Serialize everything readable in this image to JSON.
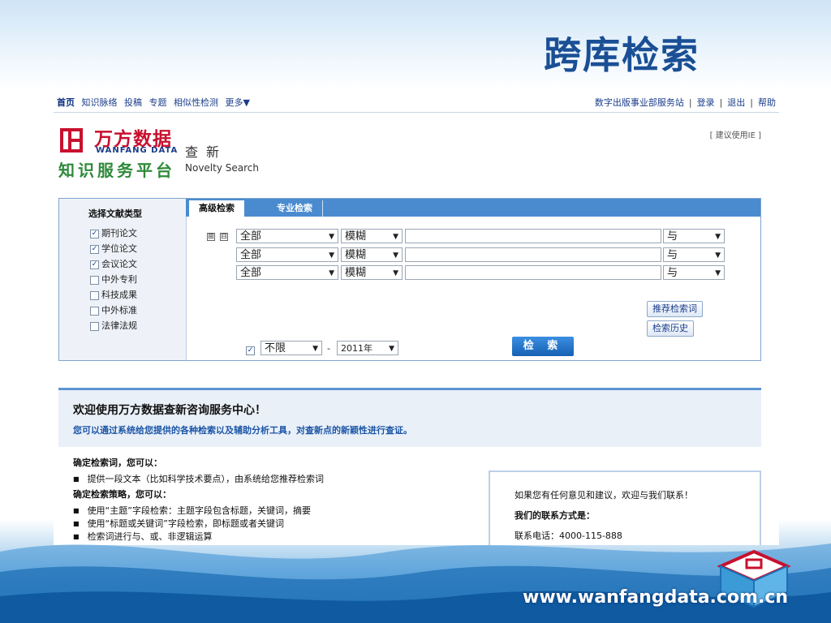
{
  "slide": {
    "title": "跨库检索",
    "url": "www.wanfangdata.com.cn"
  },
  "nav": {
    "home": "首页",
    "items": [
      "知识脉络",
      "投稿",
      "专题",
      "相似性检测",
      "更多▼"
    ],
    "right_links": [
      "数字出版事业部服务站",
      "登录",
      "退出",
      "帮助"
    ],
    "separator": "|"
  },
  "logo": {
    "cn": "万方数据",
    "en": "WANFANG DATA",
    "sub": "知识服务平台",
    "novelty_cn": "查新",
    "novelty_en": "Novelty Search"
  },
  "ie_note": "[ 建议使用IE ]",
  "doc_types": {
    "title": "选择文献类型",
    "items": [
      {
        "label": "期刊论文",
        "checked": true
      },
      {
        "label": "学位论文",
        "checked": true
      },
      {
        "label": "会议论文",
        "checked": true
      },
      {
        "label": "中外专利",
        "checked": false
      },
      {
        "label": "科技成果",
        "checked": false
      },
      {
        "label": "中外标准",
        "checked": false
      },
      {
        "label": "法律法规",
        "checked": false
      }
    ]
  },
  "tabs": [
    {
      "label": "高级检索",
      "active": true
    },
    {
      "label": "专业检索",
      "active": false
    }
  ],
  "query_rows": [
    {
      "field": "全部",
      "match": "模糊",
      "value": "",
      "logic": "与"
    },
    {
      "field": "全部",
      "match": "模糊",
      "value": "",
      "logic": "与"
    },
    {
      "field": "全部",
      "match": "模糊",
      "value": "",
      "logic": "与"
    }
  ],
  "expand_icons": [
    "⊞",
    "⊟"
  ],
  "buttons": {
    "recommend": "推荐检索词",
    "history": "检索历史",
    "search": "检 索"
  },
  "date_range": {
    "checked": true,
    "from": "不限",
    "dash": "-",
    "to": "2011年"
  },
  "welcome": {
    "title": "欢迎使用万方数据查新咨询服务中心！",
    "subtitle": "您可以通过系统给您提供的各种检索以及辅助分析工具，对查新点的新颖性进行查证。"
  },
  "help": {
    "h1": "确定检索词，您可以：",
    "h1_items": [
      "提供一段文本（比如科学技术要点），由系统给您推荐检索词"
    ],
    "h2": "确定检索策略，您可以：",
    "h2_items": [
      "使用“主题”字段检索：主题字段包含标题，关键词，摘要",
      "使用“标题或关键词”字段检索，即标题或者关键词",
      "检索词进行与、或、非逻辑运算"
    ]
  },
  "contact": {
    "line1": "如果您有任何意见和建议，欢迎与我们联系！",
    "line2": "我们的联系方式是：",
    "line3": "联系电话：4000-115-888"
  },
  "colors": {
    "title": "#1a4f95",
    "tabbar": "#4a8bd0",
    "logo_red": "#c8102e",
    "logo_green": "#2f8a3a"
  }
}
